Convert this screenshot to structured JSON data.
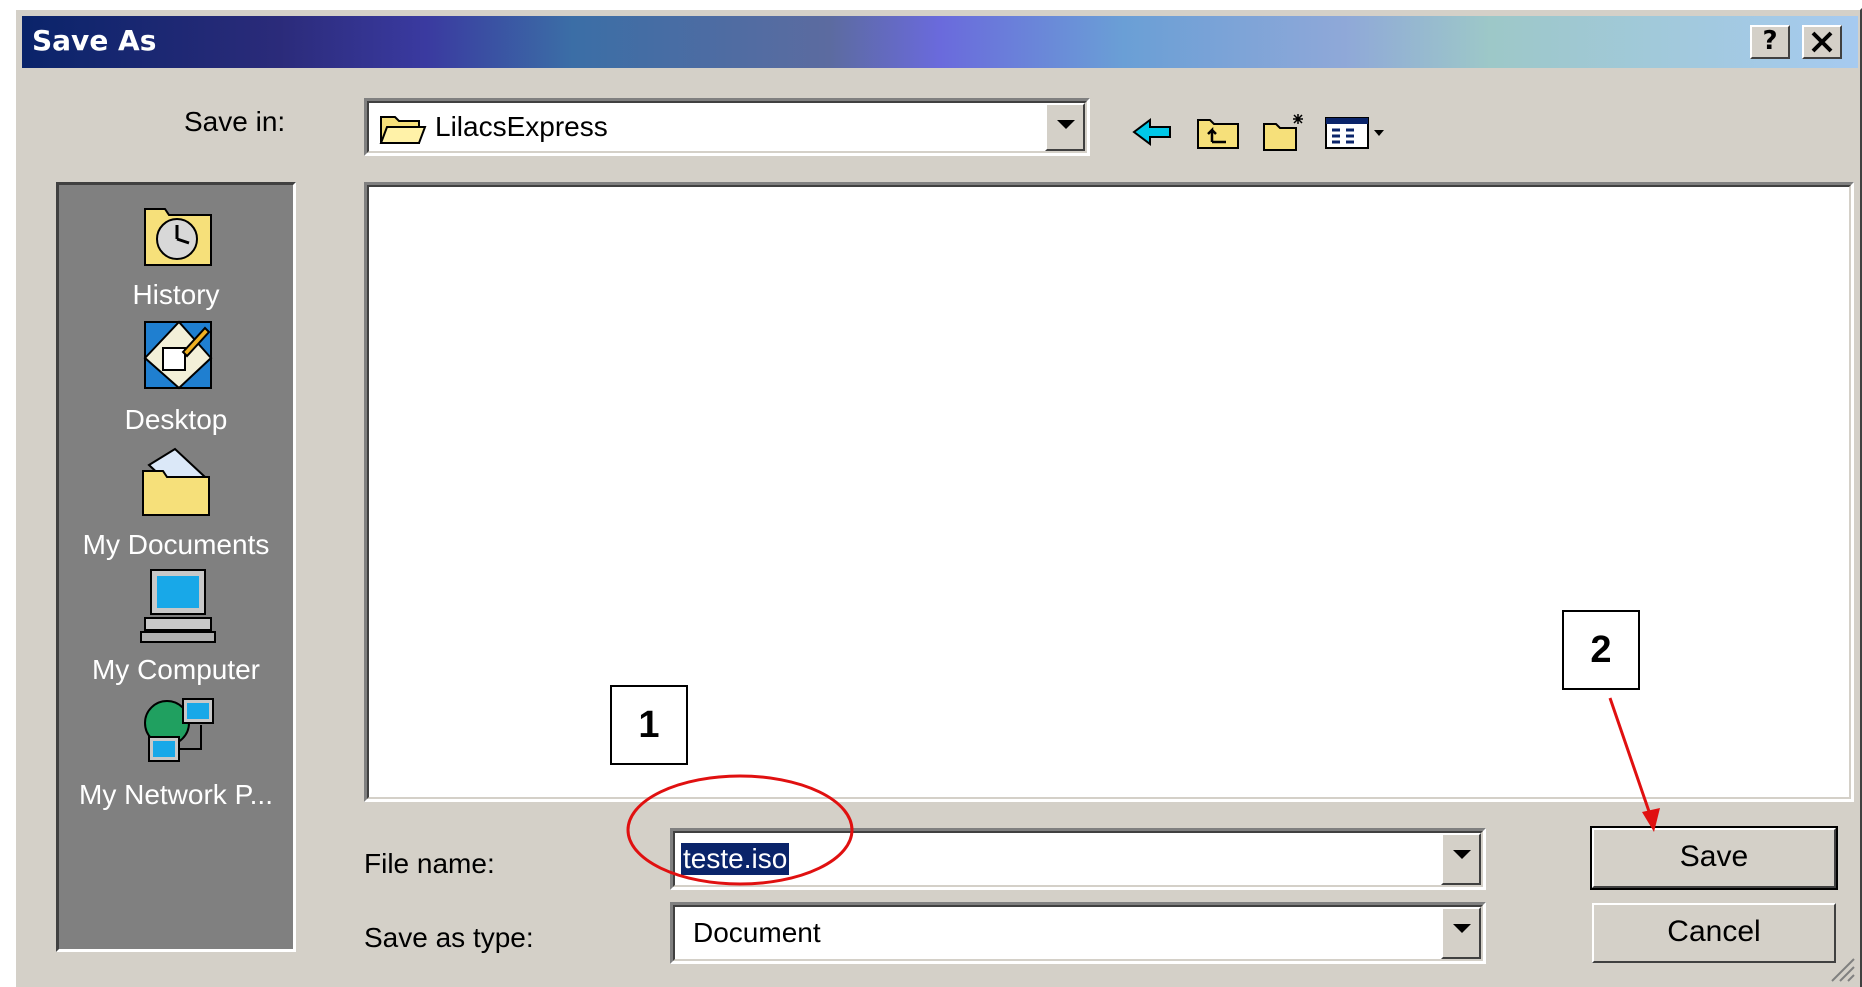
{
  "window": {
    "title": "Save As",
    "help_glyph": "?",
    "close_glyph": "✕"
  },
  "toolbar": {
    "save_in_label": "Save in:",
    "save_in_value": "LilacsExpress",
    "icons": [
      "back-icon",
      "up-folder-icon",
      "new-folder-icon",
      "view-menu-icon"
    ]
  },
  "places": [
    {
      "label": "History",
      "icon": "history-icon"
    },
    {
      "label": "Desktop",
      "icon": "desktop-icon"
    },
    {
      "label": "My Documents",
      "icon": "my-documents-icon"
    },
    {
      "label": "My Computer",
      "icon": "my-computer-icon"
    },
    {
      "label": "My Network P...",
      "icon": "my-network-icon"
    }
  ],
  "form": {
    "file_name_label": "File name:",
    "file_name_value": "teste.iso",
    "save_type_label": "Save as type:",
    "save_type_value": "Document"
  },
  "buttons": {
    "save": "Save",
    "cancel": "Cancel"
  },
  "annotations": {
    "step1": "1",
    "step2": "2"
  },
  "colors": {
    "titlebar_start": "#0a246a",
    "selection": "#0a246a",
    "annotation": "#e01010"
  }
}
